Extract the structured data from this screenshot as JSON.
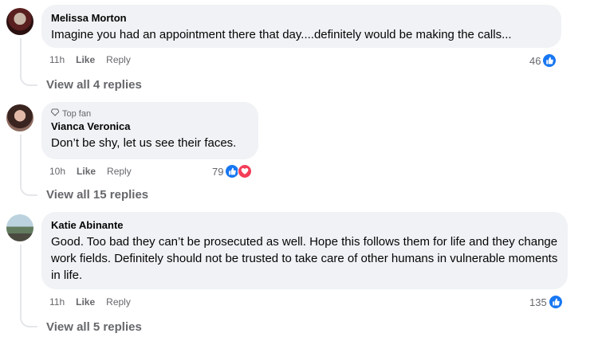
{
  "comments": [
    {
      "author": "Melissa Morton",
      "text": "Imagine you had an appointment there that day....definitely would be making the calls...",
      "time": "11h",
      "like_label": "Like",
      "reply_label": "Reply",
      "reaction_count": "46",
      "view_replies": "View all 4 replies"
    },
    {
      "badge": "Top fan",
      "author": "Vianca Veronica",
      "text": "Don’t be shy, let us see their faces.",
      "time": "10h",
      "like_label": "Like",
      "reply_label": "Reply",
      "reaction_count": "79",
      "view_replies": "View all 15 replies"
    },
    {
      "author": "Katie Abinante",
      "text": "Good. Too bad they can’t be prosecuted as well. Hope this follows them for life and they change work fields. Definitely should not be trusted to take care of other humans in vulnerable moments in life.",
      "time": "11h",
      "like_label": "Like",
      "reply_label": "Reply",
      "reaction_count": "135",
      "view_replies": "View all 5 replies"
    }
  ],
  "colors": {
    "bubble": "#f0f2f5",
    "like_blue": "#1877f2",
    "love_red": "#f33e58",
    "meta_gray": "#65676b"
  }
}
